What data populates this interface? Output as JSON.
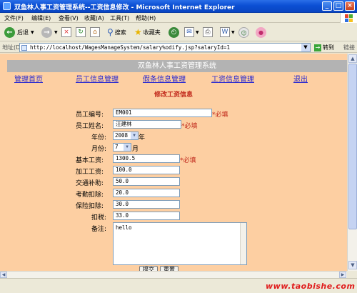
{
  "window": {
    "title": "双鱼林人事工资管理系统--工资信息修改 - Microsoft Internet Explorer"
  },
  "menu": [
    "文件(F)",
    "编辑(E)",
    "查看(V)",
    "收藏(A)",
    "工具(T)",
    "帮助(H)"
  ],
  "toolbar": {
    "back": "后退",
    "search": "搜索",
    "favorites": "收藏夹"
  },
  "address": {
    "label": "地址(D)",
    "url": "http://localhost/WagesManageSystem/salary%odify.jsp?salaryId=1",
    "go": "转到",
    "links": "链接"
  },
  "header": {
    "system_title": "双鱼林人事工资管理系统"
  },
  "nav": [
    "管理首页",
    "员工信息管理",
    "假条信息管理",
    "工资信息管理",
    "退出"
  ],
  "form": {
    "title": "修改工资信息",
    "required_text": "*必填",
    "fields": {
      "employee_no": {
        "label": "员工编号:",
        "value": "EM001"
      },
      "employee_name": {
        "label": "员工姓名:",
        "value": "汪建林"
      },
      "year": {
        "label": "年份:",
        "value": "2008",
        "suffix": "年"
      },
      "month": {
        "label": "月份:",
        "value": "7",
        "suffix": "月"
      },
      "base_salary": {
        "label": "基本工资:",
        "value": "1300.5"
      },
      "overtime": {
        "label": "加工工资:",
        "value": "100.0"
      },
      "transport": {
        "label": "交通补助:",
        "value": "50.0"
      },
      "attendance_deduction": {
        "label": "考勤扣除:",
        "value": "20.0"
      },
      "insurance_deduction": {
        "label": "保险扣除:",
        "value": "30.0"
      },
      "tax": {
        "label": "扣税:",
        "value": "33.0"
      },
      "remark": {
        "label": "备注:",
        "value": "hello"
      }
    },
    "submit": "提交",
    "reset": "重置"
  },
  "status": {
    "watermark": "www.taobishe.com"
  },
  "colors": {
    "page_bg": "#fdcfa2",
    "header_bar": "#b3b3b3",
    "accent_red": "#c0271a",
    "link_blue": "#2b2bd0"
  }
}
